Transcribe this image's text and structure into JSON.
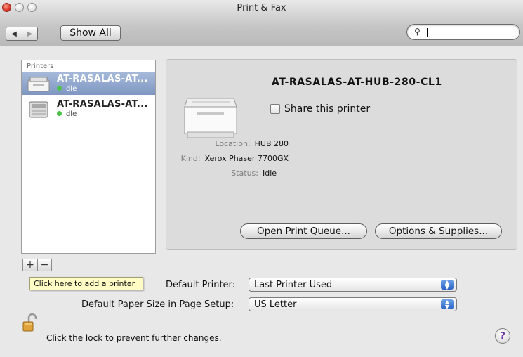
{
  "window": {
    "title": "Print & Fax"
  },
  "toolbar": {
    "back_icon": "back-arrow-icon",
    "forward_icon": "forward-arrow-icon",
    "show_all_label": "Show All",
    "search": {
      "placeholder": "",
      "value": "",
      "icon": "magnifier-icon"
    }
  },
  "printers": {
    "header": "Printers",
    "items": [
      {
        "name": "AT-RASALAS-AT...",
        "status": "Idle",
        "selected": true
      },
      {
        "name": "AT-RASALAS-AT...",
        "status": "Idle",
        "selected": false
      }
    ]
  },
  "list_controls": {
    "add_label": "+",
    "remove_label": "−"
  },
  "tooltip": {
    "text": "Click here to add a printer"
  },
  "detail": {
    "name": "AT-RASALAS-AT-HUB-280-CL1",
    "share_label": "Share this printer",
    "share_checked": false,
    "info": [
      {
        "label": "Location:",
        "value": "HUB 280"
      },
      {
        "label": "Kind:",
        "value": "Xerox Phaser 7700GX"
      },
      {
        "label": "Status:",
        "value": "Idle"
      }
    ],
    "open_queue_label": "Open Print Queue...",
    "options_label": "Options & Supplies..."
  },
  "defaults": {
    "printer_label": "Default Printer:",
    "printer_value": "Last Printer Used",
    "paper_label": "Default Paper Size in Page Setup:",
    "paper_value": "US Letter"
  },
  "footer": {
    "lock_text": "Click the lock to prevent further changes.",
    "help_label": "?"
  },
  "colors": {
    "selection": "#8ea5cf",
    "status_green": "#4bc248",
    "tooltip_bg": "#fefcc4"
  }
}
